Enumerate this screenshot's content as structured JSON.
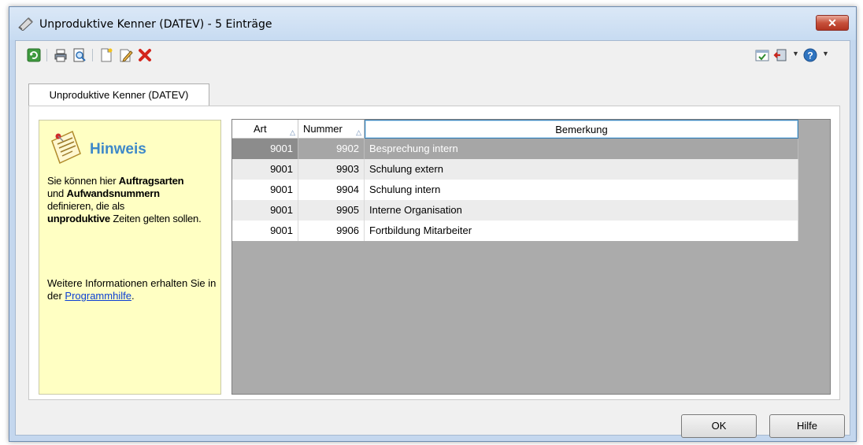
{
  "window": {
    "title": "Unproduktive Kenner (DATEV) - 5 Einträge",
    "close_label": "✕"
  },
  "toolbar": {
    "left": [
      {
        "name": "refresh-icon",
        "glyph": "⟳"
      },
      {
        "name": "print-icon",
        "glyph": "⎙"
      },
      {
        "name": "print-preview-icon",
        "glyph": "🔍"
      },
      {
        "name": "new-document-icon",
        "glyph": "📄"
      },
      {
        "name": "edit-icon",
        "glyph": "✎"
      },
      {
        "name": "delete-icon",
        "glyph": "✖"
      }
    ],
    "right": [
      {
        "name": "checklist-icon"
      },
      {
        "name": "exit-icon"
      },
      {
        "name": "help-icon",
        "glyph": "?"
      }
    ]
  },
  "tabs": [
    {
      "label": "Unproduktive Kenner (DATEV)"
    }
  ],
  "hint": {
    "title": "Hinweis",
    "text_1": "Sie können hier ",
    "bold_1": "Auftragsarten",
    "text_2": "und ",
    "bold_2": "Aufwandsnummern",
    "text_3": "definieren, die als",
    "bold_3": "unproduktive",
    "text_4": " Zeiten gelten sollen.",
    "more_text": "Weitere Informationen erhalten Sie in der ",
    "link": "Programmhilfe",
    "after_link": "."
  },
  "table": {
    "columns": [
      {
        "label": "Art",
        "sort": "△"
      },
      {
        "label": "Nummer",
        "sort": "△"
      },
      {
        "label": "Bemerkung",
        "sort": ""
      }
    ],
    "rows": [
      {
        "art": "9001",
        "nummer": "9902",
        "bemerkung": "Besprechung intern",
        "state": "selected"
      },
      {
        "art": "9001",
        "nummer": "9903",
        "bemerkung": "Schulung extern",
        "state": "alt"
      },
      {
        "art": "9001",
        "nummer": "9904",
        "bemerkung": "Schulung intern",
        "state": "normal"
      },
      {
        "art": "9001",
        "nummer": "9905",
        "bemerkung": "Interne Organisation",
        "state": "alt"
      },
      {
        "art": "9001",
        "nummer": "9906",
        "bemerkung": "Fortbildung Mitarbeiter",
        "state": "normal"
      }
    ]
  },
  "buttons": {
    "ok": "OK",
    "help": "Hilfe"
  }
}
